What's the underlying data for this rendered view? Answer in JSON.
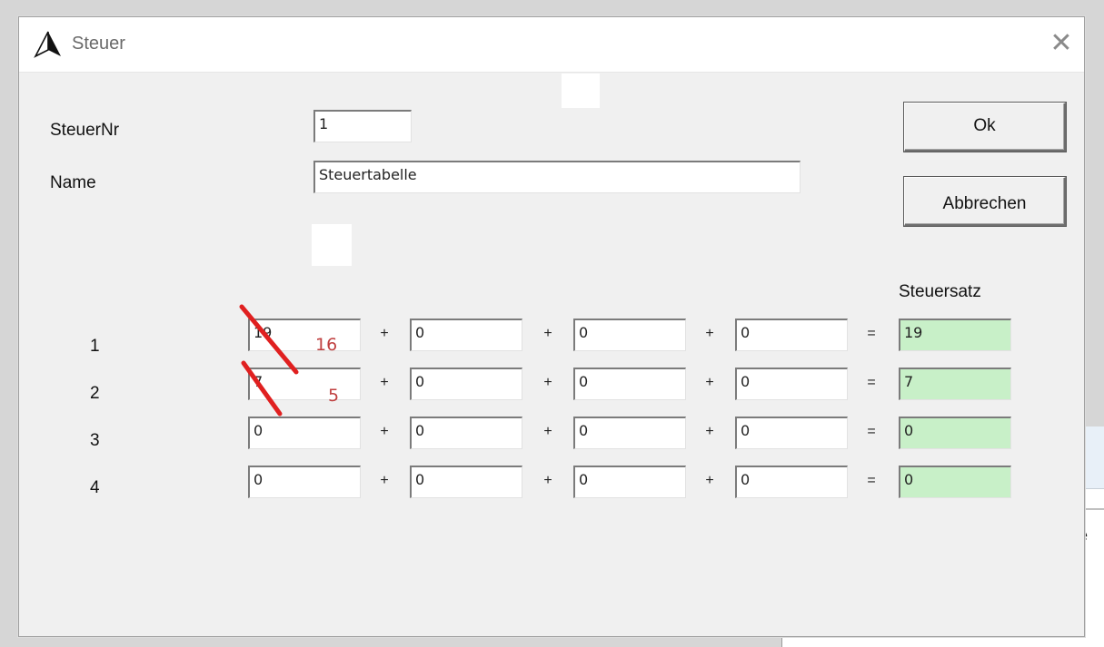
{
  "background": {
    "partial_text": "le"
  },
  "dialog": {
    "title": "Steuer",
    "icon": "triangle-app-icon",
    "close_glyph": "✕"
  },
  "form": {
    "steuernr_label": "SteuerNr",
    "steuernr_value": "1",
    "name_label": "Name",
    "name_value": "Steuertabelle"
  },
  "buttons": {
    "ok": "Ok",
    "cancel": "Abbrechen"
  },
  "table": {
    "rate_header": "Steuersatz",
    "rows": [
      {
        "num": "1",
        "f1": "19",
        "f2": "0",
        "f3": "0",
        "f4": "0",
        "rate": "19",
        "plus": "+",
        "eq": "="
      },
      {
        "num": "2",
        "f1": "7",
        "f2": "0",
        "f3": "0",
        "f4": "0",
        "rate": "7",
        "plus": "+",
        "eq": "="
      },
      {
        "num": "3",
        "f1": "0",
        "f2": "0",
        "f3": "0",
        "f4": "0",
        "rate": "0",
        "plus": "+",
        "eq": "="
      },
      {
        "num": "4",
        "f1": "0",
        "f2": "0",
        "f3": "0",
        "f4": "0",
        "rate": "0",
        "plus": "+",
        "eq": "="
      }
    ]
  },
  "annotations": {
    "row1_new": "16",
    "row2_new": "5",
    "strike_color": "#e02020"
  },
  "colors": {
    "rate_field_bg": "#c8f0c8",
    "dialog_bg": "#f0f0f0"
  }
}
